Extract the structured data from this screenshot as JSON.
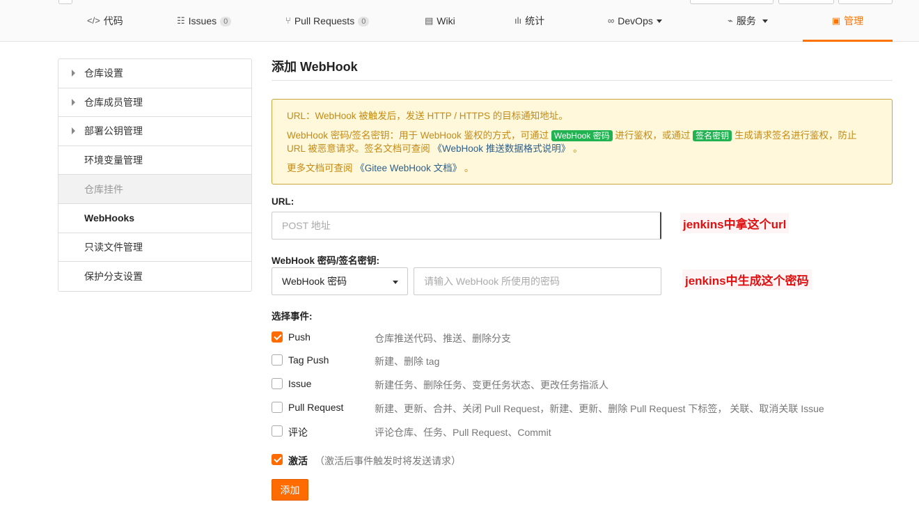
{
  "tabs": [
    {
      "icon": "</>",
      "label": "代码"
    },
    {
      "icon": "☷",
      "label": "Issues",
      "badge": "0"
    },
    {
      "icon": "⑂",
      "label": "Pull Requests",
      "badge": "0"
    },
    {
      "icon": "▤",
      "label": "Wiki"
    },
    {
      "icon": "ılı",
      "label": "统计"
    },
    {
      "icon": "∞",
      "label": "DevOps"
    },
    {
      "icon": "⌁",
      "label": "服务"
    },
    {
      "icon": "▣",
      "label": "管理"
    }
  ],
  "sidebar": {
    "items": [
      {
        "label": "仓库设置"
      },
      {
        "label": "仓库成员管理"
      },
      {
        "label": "部署公钥管理"
      },
      {
        "label": "环境变量管理"
      },
      {
        "label": "仓库挂件"
      },
      {
        "label": "WebHooks"
      },
      {
        "label": "只读文件管理"
      },
      {
        "label": "保护分支设置"
      }
    ]
  },
  "main": {
    "title": "添加 WebHook",
    "notice": {
      "line1": "URL：WebHook 被触发后，发送 HTTP / HTTPS 的目标通知地址。",
      "line2a": "WebHook 密码/签名密钥：用于 WebHook 鉴权的方式，可通过",
      "pill1": "WebHook 密码",
      "line2b": "进行鉴权，或通过",
      "pill2": "签名密钥",
      "line2c": "生成请求签名进行鉴权，防止 URL 被恶意请求。签名文档可查阅",
      "link1": "《WebHook 推送数据格式说明》",
      "line2d": "。",
      "line3a": "更多文档可查阅",
      "link2": "《Gitee WebHook 文档》",
      "line3b": "。"
    },
    "url_label": "URL:",
    "url_placeholder": "POST 地址",
    "secret_label": "WebHook 密码/签名密钥:",
    "secret_select": "WebHook 密码",
    "secret_placeholder": "请输入 WebHook 所使用的密码",
    "annotation_url": "jenkins中拿这个url",
    "annotation_secret": "jenkins中生成这个密码",
    "events_label": "选择事件:",
    "events": [
      {
        "name": "Push",
        "desc": "仓库推送代码、推送、删除分支",
        "checked": true
      },
      {
        "name": "Tag Push",
        "desc": "新建、删除 tag",
        "checked": false
      },
      {
        "name": "Issue",
        "desc": "新建任务、删除任务、变更任务状态、更改任务指派人",
        "checked": false
      },
      {
        "name": "Pull Request",
        "desc": "新建、更新、合并、关闭 Pull Request，新建、更新、删除 Pull Request 下标签， 关联、取消关联 Issue",
        "checked": false
      },
      {
        "name": "评论",
        "desc": "评论仓库、任务、Pull Request、Commit",
        "checked": false
      }
    ],
    "activate_label": "激活",
    "activate_hint": "（激活后事件触发时将发送请求）",
    "add_button": "添加"
  }
}
